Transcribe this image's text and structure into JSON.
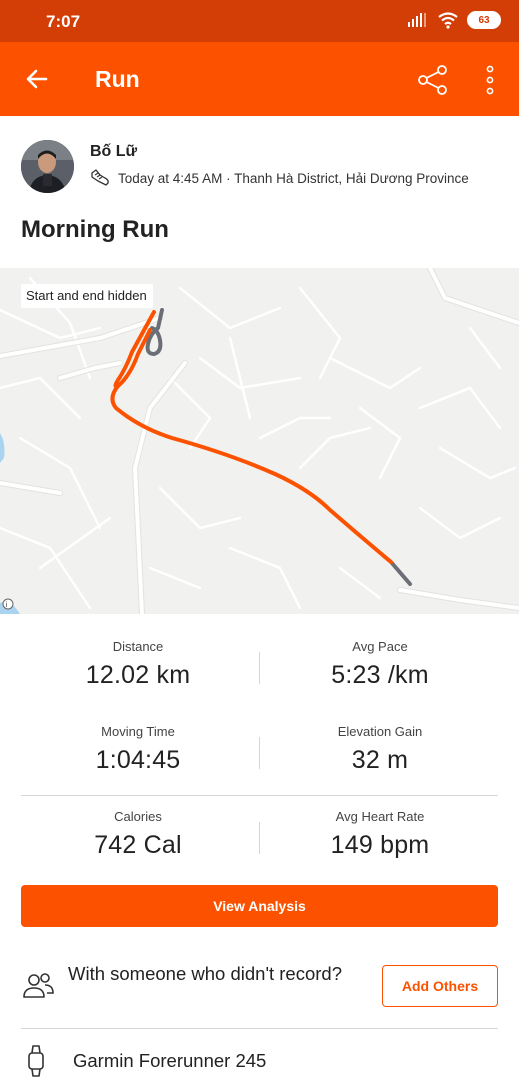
{
  "status_bar": {
    "time": "7:07",
    "battery": "63"
  },
  "app_bar": {
    "title": "Run"
  },
  "athlete": {
    "name": "Bố Lữ",
    "meta": "Today at 4:45 AM · Thanh Hà District, Hải Dương Province"
  },
  "activity": {
    "title": "Morning Run"
  },
  "map": {
    "label": "Start and end hidden",
    "route_color": "#fc5200"
  },
  "stats": [
    {
      "label": "Distance",
      "value": "12.02 km"
    },
    {
      "label": "Avg Pace",
      "value": "5:23 /km"
    },
    {
      "label": "Moving Time",
      "value": "1:04:45"
    },
    {
      "label": "Elevation Gain",
      "value": "32 m"
    },
    {
      "label": "Calories",
      "value": "742 Cal"
    },
    {
      "label": "Avg Heart Rate",
      "value": "149 bpm"
    }
  ],
  "actions": {
    "view_analysis": "View Analysis",
    "add_others": "Add Others"
  },
  "others": {
    "prompt": "With someone who didn't record?"
  },
  "device": {
    "name": "Garmin Forerunner 245"
  },
  "colors": {
    "brand": "#fc5200",
    "status_bar": "#d33d06"
  },
  "icons": [
    "back-arrow-icon",
    "share-icon",
    "more-vertical-icon",
    "shoe-icon",
    "people-icon",
    "watch-icon",
    "wifi-icon",
    "signal-icon"
  ]
}
